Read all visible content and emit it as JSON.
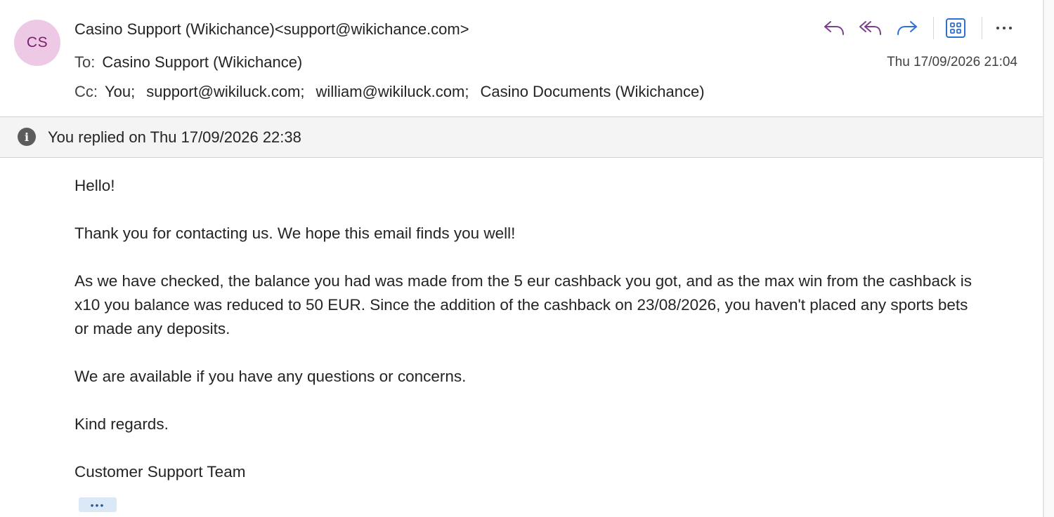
{
  "header": {
    "avatar_initials": "CS",
    "sender": "Casino Support (Wikichance)<support@wikichance.com>",
    "to_label": "To:",
    "to_value": "Casino Support (Wikichance)",
    "cc_label": "Cc:",
    "cc": [
      "You;",
      "support@wikiluck.com;",
      "william@wikiluck.com;",
      "Casino Documents (Wikichance)"
    ],
    "timestamp": "Thu 17/09/2026 21:04"
  },
  "toolbar": {
    "icons": [
      "reply-icon",
      "reply-all-icon",
      "forward-icon",
      "apps-icon",
      "more-actions-icon"
    ]
  },
  "info_bar": {
    "text": "You replied on Thu 17/09/2026 22:38"
  },
  "body": {
    "greeting": "Hello!",
    "paragraph1": "Thank you for contacting us. We hope this email finds you well!",
    "paragraph2": "As we have checked, the balance you had was made from the 5 eur cashback you got, and as the max win from the cashback is x10 you balance was reduced to 50 EUR. Since the addition of the cashback on 23/08/2026, you haven't placed any sports bets or made any deposits.",
    "paragraph3": "We are available if you have any questions or concerns.",
    "closing": "Kind regards.",
    "signature": "Customer Support Team"
  },
  "more_button": {
    "label": "•••"
  },
  "colors": {
    "avatar_bg": "#eec9e6",
    "avatar_text": "#7a1f6e",
    "reply_icon": "#7b3f8e",
    "forward_icon": "#2f6fd1",
    "info_bar_bg": "#f4f4f4"
  }
}
